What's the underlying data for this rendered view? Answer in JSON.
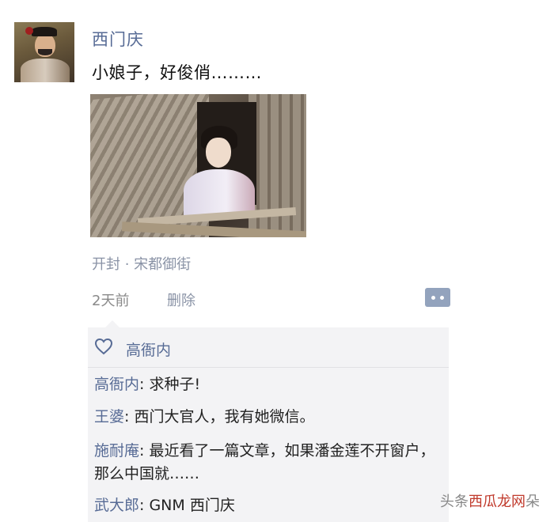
{
  "post": {
    "username": "西门庆",
    "text": "小娘子，好俊俏………",
    "location": "开封 · 宋都御街",
    "time": "2天前",
    "delete_label": "删除"
  },
  "likes": {
    "icon": "heart-icon",
    "names": "高衙内"
  },
  "comments": [
    {
      "name": "高衙内",
      "text": ": 求种子!"
    },
    {
      "name": "王婆",
      "text": ": 西门大官人，我有她微信。"
    },
    {
      "name": "施耐庵",
      "text": ": 最近看了一篇文章，如果潘金莲不开窗户，那么中国就……"
    },
    {
      "name": "武大郎",
      "text": ": GNM 西门庆"
    }
  ],
  "watermark": {
    "part1": "头条",
    "part2": "西瓜",
    "part3": "龙网",
    "part4": "朵"
  }
}
